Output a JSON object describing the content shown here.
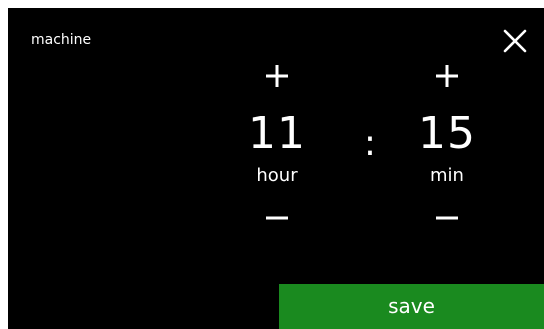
{
  "header": {
    "title": "machine",
    "close_icon": "close-icon"
  },
  "time": {
    "hour": {
      "value": "11",
      "unit": "hour",
      "increment_icon": "plus-icon",
      "decrement_icon": "minus-icon"
    },
    "separator": ":",
    "minute": {
      "value": "15",
      "unit": "min",
      "increment_icon": "plus-icon",
      "decrement_icon": "minus-icon"
    }
  },
  "footer": {
    "save_label": "save"
  },
  "colors": {
    "background": "#000000",
    "text": "#ffffff",
    "save_button": "#1a8a1f"
  }
}
